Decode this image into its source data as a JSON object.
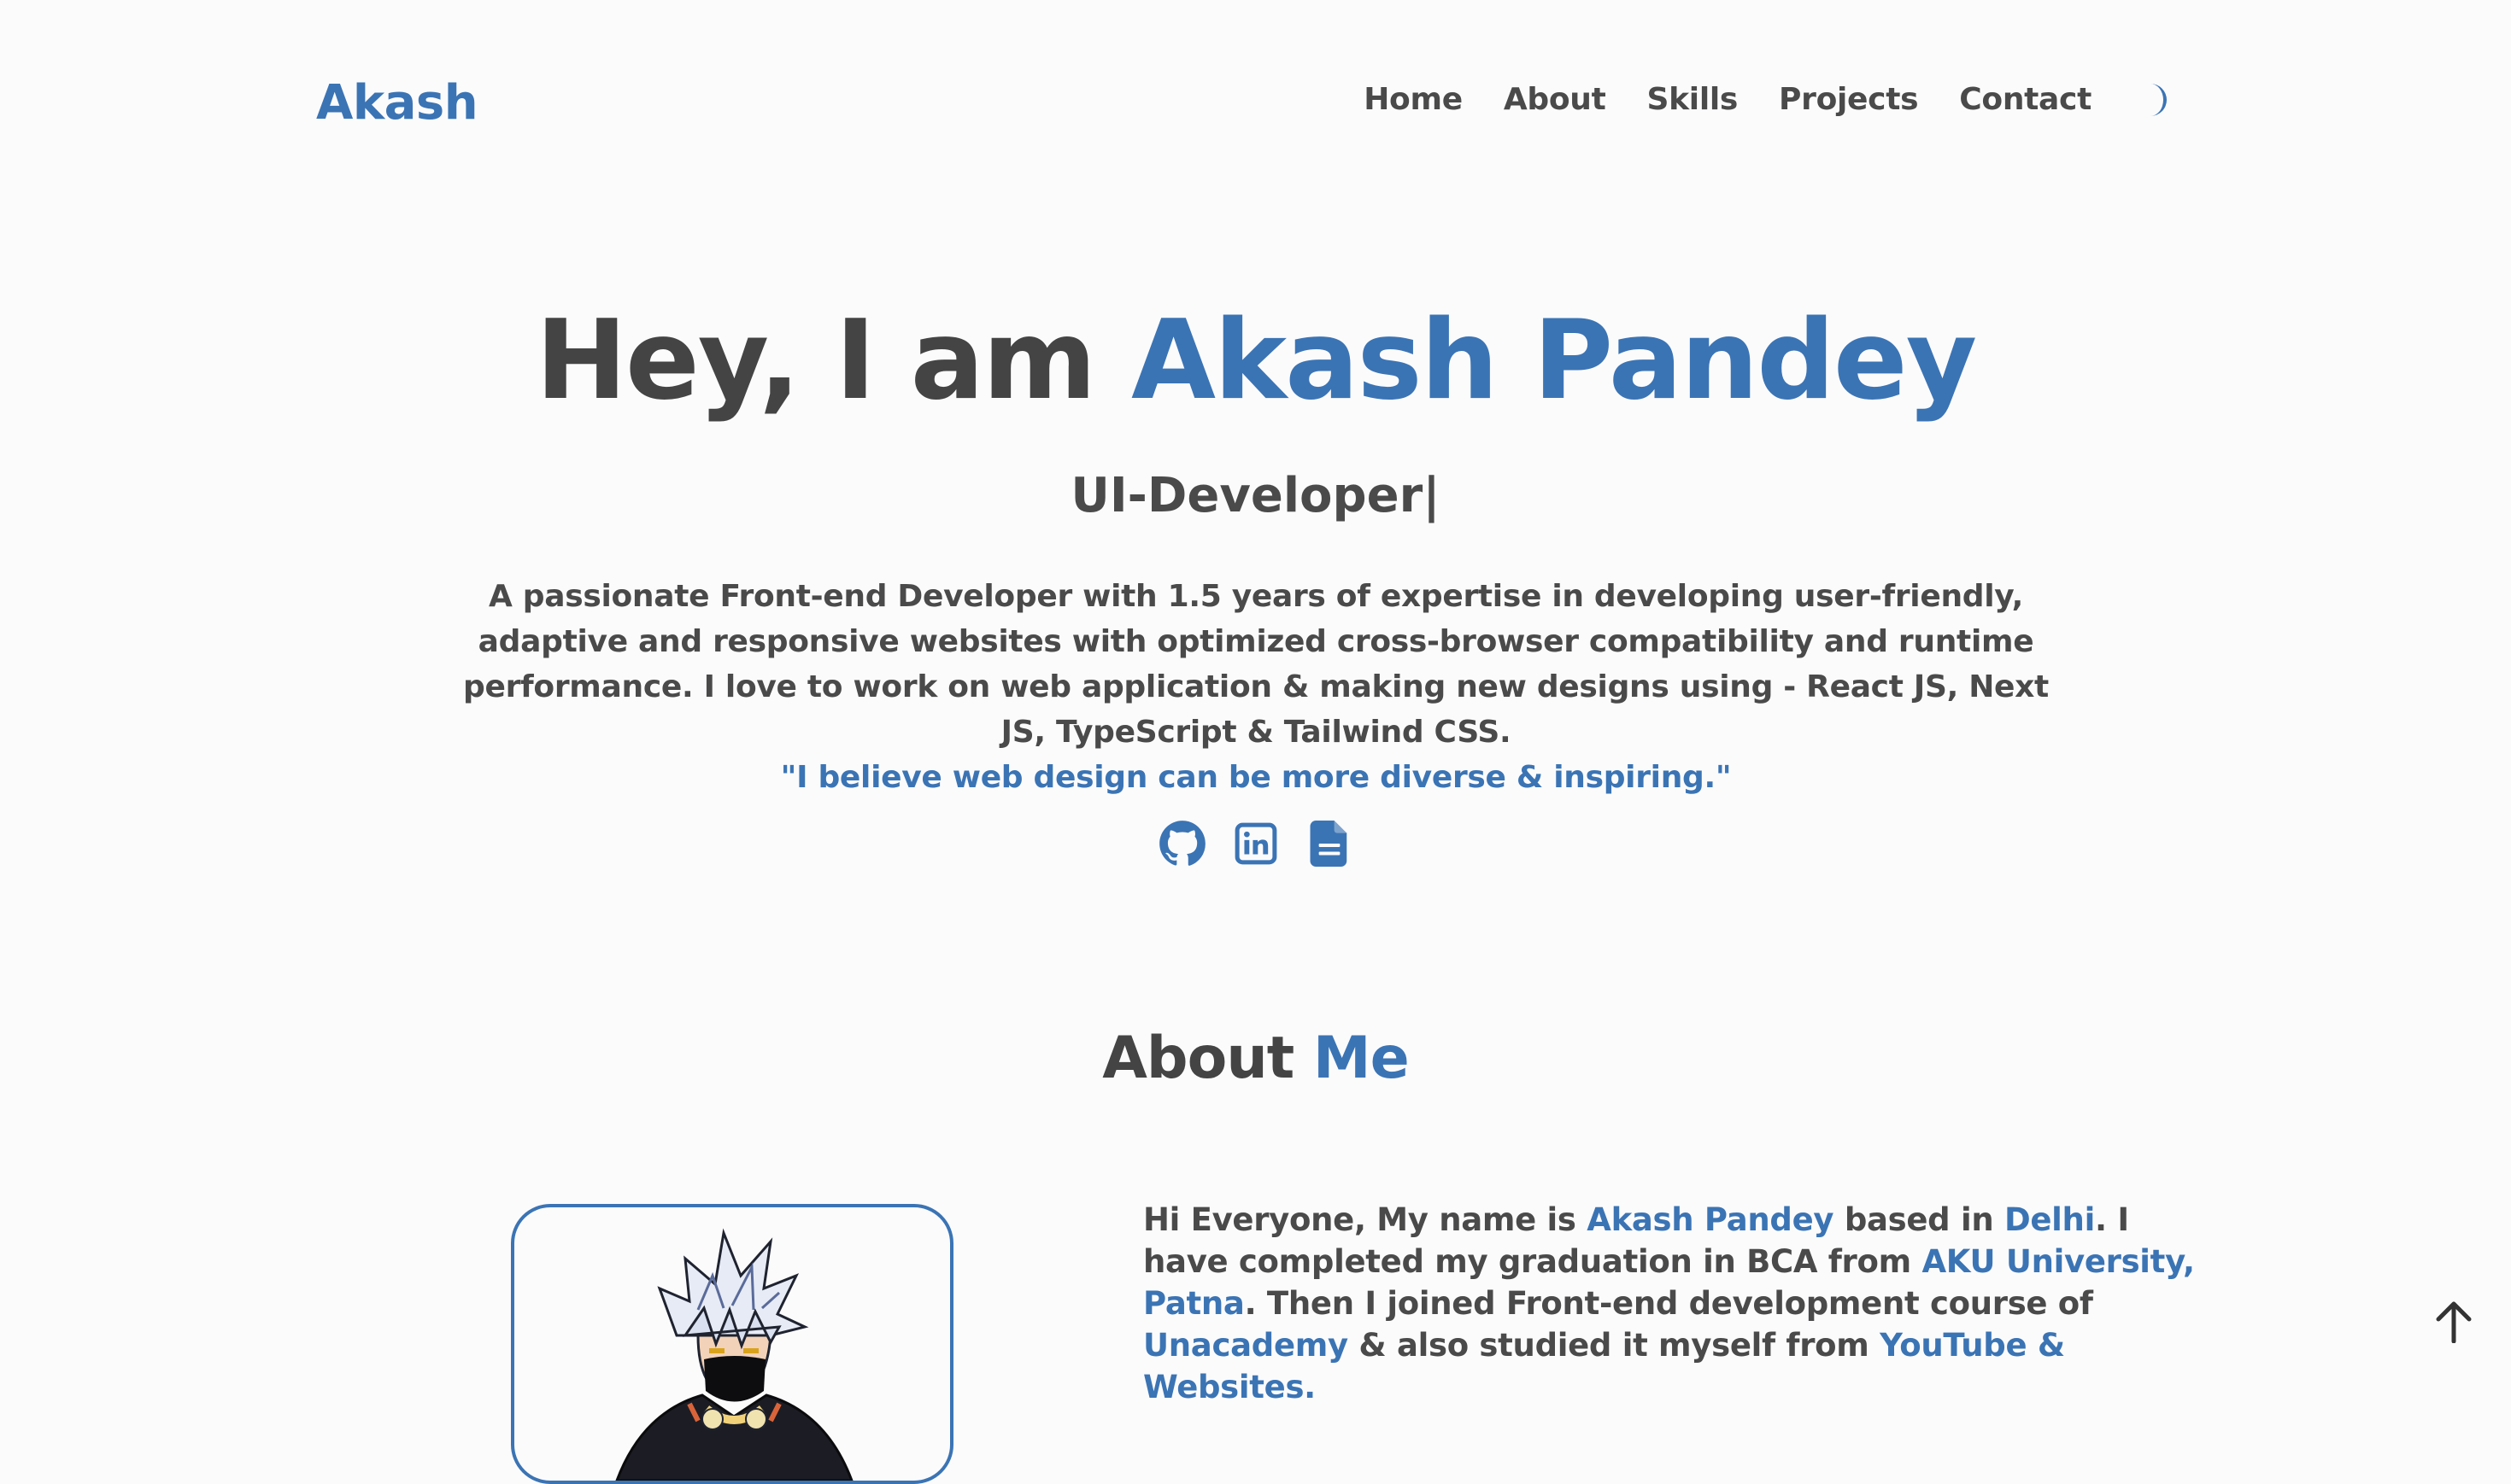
{
  "nav": {
    "logo": "Akash",
    "links": [
      "Home",
      "About",
      "Skills",
      "Projects",
      "Contact"
    ]
  },
  "hero": {
    "greeting": "Hey, I am ",
    "name": "Akash Pandey",
    "role": "UI-Developer|",
    "description": "A passionate Front-end Developer with 1.5 years of expertise in developing user-friendly, adaptive and responsive websites with optimized cross-browser compatibility and runtime performance. I love to work on web application & making new designs using - React JS, Next JS, TypeScript & Tailwind CSS.",
    "quote": "\"I believe web design can be more diverse & inspiring.\"",
    "social_icons": [
      "github-icon",
      "linkedin-icon",
      "resume-document-icon"
    ]
  },
  "about": {
    "title_plain": "About ",
    "title_accent": "Me",
    "p1": "Hi Everyone, My name is ",
    "name": "Akash Pandey",
    "p2": " based in ",
    "city": "Delhi",
    "p3": ". I have completed my graduation in BCA from ",
    "university": "AKU University, Patna",
    "p4": ". Then I joined Front-end development course of ",
    "course": "Unacademy",
    "p5": " & also studied it myself from ",
    "sources": "YouTube & Websites."
  },
  "colors": {
    "accent": "#3b74b4",
    "text": "#444444",
    "background": "#fbfbfc"
  },
  "icons": {
    "theme_toggle": "moon-icon",
    "back_to_top": "arrow-up-icon"
  }
}
